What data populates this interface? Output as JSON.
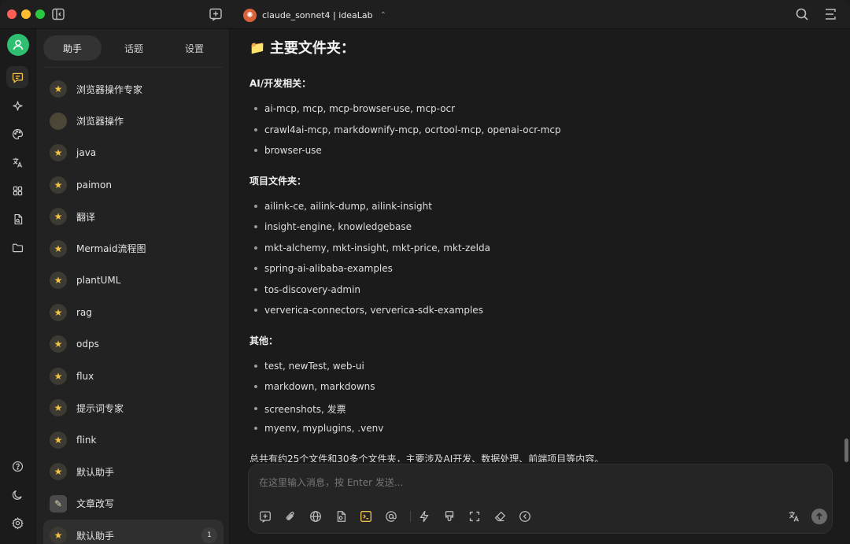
{
  "titlebar": {
    "model_name": "claude_sonnet4 | ideaLab"
  },
  "sidebar": {
    "tabs": [
      "助手",
      "话题",
      "设置"
    ],
    "active_tab": 0,
    "assistants": [
      {
        "name": "浏览器操作专家",
        "icon": "star-emoji"
      },
      {
        "name": "浏览器操作",
        "icon": "blank-avatar"
      },
      {
        "name": "java",
        "icon": "star-emoji"
      },
      {
        "name": "paimon",
        "icon": "star-emoji"
      },
      {
        "name": "翻译",
        "icon": "star-emoji"
      },
      {
        "name": "Mermaid流程图",
        "icon": "star-emoji"
      },
      {
        "name": "plantUML",
        "icon": "star-emoji"
      },
      {
        "name": "rag",
        "icon": "star-emoji"
      },
      {
        "name": "odps",
        "icon": "star-emoji"
      },
      {
        "name": "flux",
        "icon": "star-emoji"
      },
      {
        "name": "提示词专家",
        "icon": "star-emoji"
      },
      {
        "name": "flink",
        "icon": "star-emoji"
      },
      {
        "name": "默认助手",
        "icon": "star-emoji"
      },
      {
        "name": "文章改写",
        "icon": "memo-emoji"
      },
      {
        "name": "默认助手",
        "icon": "star-emoji",
        "badge": "1",
        "active": true
      }
    ]
  },
  "content": {
    "heading": "主要文件夹：",
    "sections": [
      {
        "title": "AI/开发相关：",
        "items": [
          "ai-mcp, mcp, mcp-browser-use, mcp-ocr",
          "crawl4ai-mcp, markdownify-mcp, ocrtool-mcp, openai-ocr-mcp",
          "browser-use"
        ]
      },
      {
        "title": "项目文件夹：",
        "items": [
          "ailink-ce, ailink-dump, ailink-insight",
          "insight-engine, knowledgebase",
          "mkt-alchemy, mkt-insight, mkt-price, mkt-zelda",
          "spring-ai-alibaba-examples",
          "tos-discovery-admin",
          "ververica-connectors, ververica-sdk-examples"
        ]
      },
      {
        "title": "其他：",
        "items": [
          "test, newTest, web-ui",
          "markdown, markdowns",
          "screenshots, 发票",
          "myenv, myplugins, .venv"
        ]
      }
    ],
    "summary": "总共有约25个文件和30多个文件夹，主要涉及AI开发、数据处理、前端项目等内容。"
  },
  "input": {
    "placeholder": "在这里输入消息，按 Enter 发送..."
  }
}
